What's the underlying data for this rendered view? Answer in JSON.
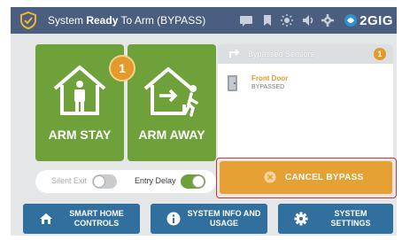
{
  "status_bar": {
    "status_prefix": "System ",
    "status_bold": "Ready",
    "status_suffix": " To Arm (BYPASS)",
    "icons": [
      "messages-icon",
      "bookmark-icon",
      "brightness-icon",
      "volume-icon",
      "settings-gear-icon"
    ],
    "brand": "2GIG"
  },
  "arm": {
    "stay_label": "ARM STAY",
    "away_label": "ARM AWAY",
    "badge": "1"
  },
  "toggles": {
    "silent_exit_label": "Silent Exit",
    "silent_exit_on": false,
    "entry_delay_label": "Entry Delay",
    "entry_delay_on": true
  },
  "bypassed": {
    "title": "Bypassed Sensors",
    "count": "1",
    "sensors": [
      {
        "name": "Front Door",
        "status": "BYPASSED"
      }
    ]
  },
  "cancel_bypass_label": "CANCEL BYPASS",
  "nav": {
    "smart_home": "SMART HOME CONTROLS",
    "system_info": "SYSTEM INFO AND USAGE",
    "system_settings": "SYSTEM SETTINGS"
  },
  "colors": {
    "status_bar": "#4a5f7f",
    "arm_green": "#6fa13b",
    "accent_orange": "#e49a2a",
    "cancel_orange": "#e6a134",
    "nav_blue": "#31709e",
    "highlight_red": "#c0392b"
  }
}
